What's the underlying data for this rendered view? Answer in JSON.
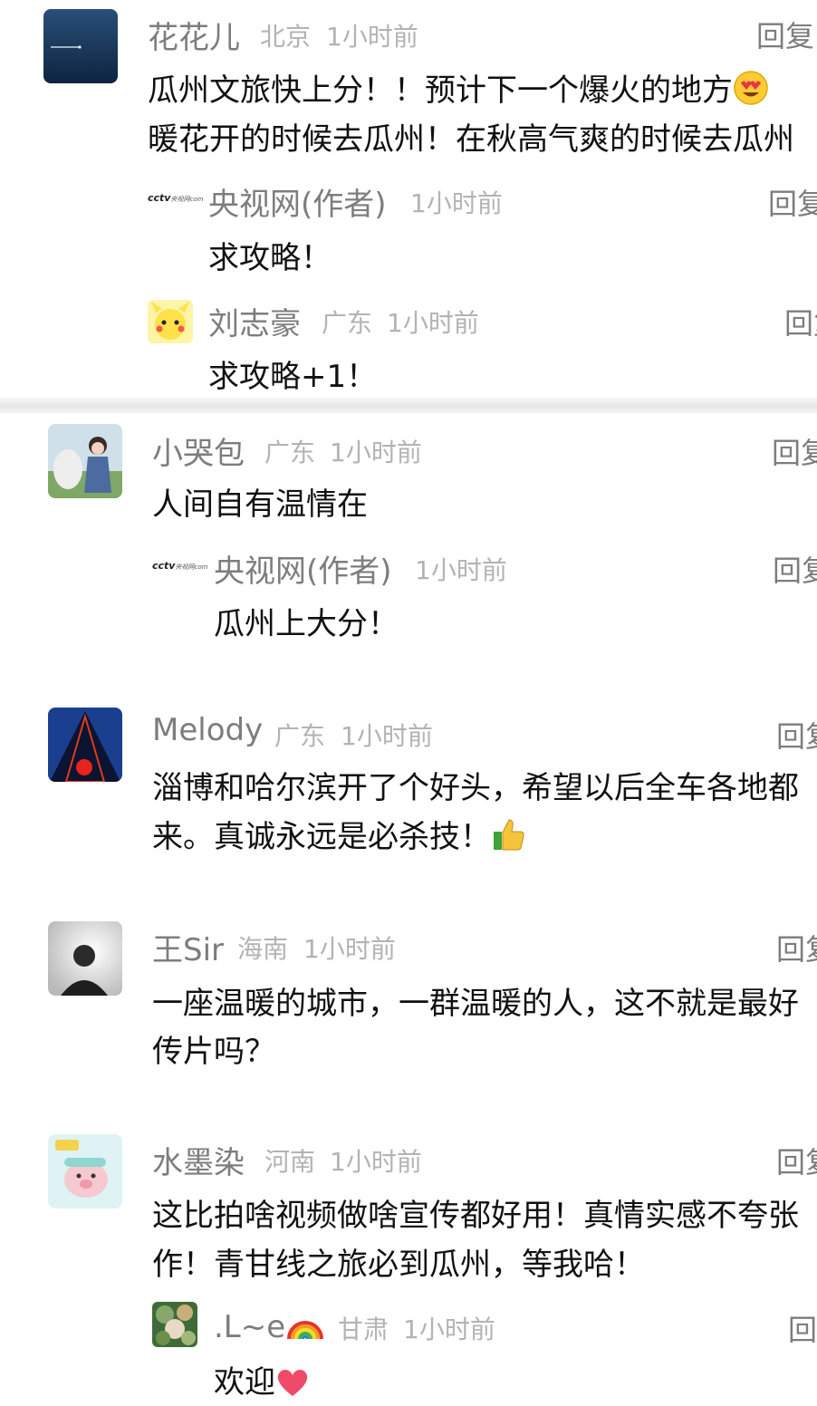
{
  "labels": {
    "reply": "回复",
    "reply_truncated": "回复",
    "cctv_logo": "cctv",
    "cctv_logo_sub": "央视网com"
  },
  "comments": [
    {
      "name": "花花儿",
      "location": "北京",
      "time": "1小时前",
      "lines": [
        "瓜州文旅快上分！！预计下一个爆火的地方",
        "暖花开的时候去瓜州！在秋高气爽的时候去瓜州"
      ],
      "emoji": "heart-eyes-emoji",
      "replies": [
        {
          "name": "央视网(作者)",
          "location": "",
          "time": "1小时前",
          "text": "求攻略！"
        },
        {
          "name": "刘志豪",
          "location": "广东",
          "time": "1小时前",
          "text": "求攻略+1！"
        }
      ]
    },
    {
      "name": "小哭包",
      "location": "广东",
      "time": "1小时前",
      "lines": [
        "人间自有温情在"
      ],
      "replies": [
        {
          "name": "央视网(作者)",
          "location": "",
          "time": "1小时前",
          "text": "瓜州上大分！"
        }
      ]
    },
    {
      "name": "Melody",
      "location": "广东",
      "time": "1小时前",
      "lines": [
        "淄博和哈尔滨开了个好头，希望以后全车各地都",
        "来。真诚永远是必杀技！"
      ],
      "emoji": "thumbs-up-emoji"
    },
    {
      "name": "王Sir",
      "location": "海南",
      "time": "1小时前",
      "lines": [
        "一座温暖的城市，一群温暖的人，这不就是最好",
        "传片吗？"
      ]
    },
    {
      "name": "水墨染",
      "location": "河南",
      "time": "1小时前",
      "lines": [
        "这比拍啥视频做啥宣传都好用！真情实感不夸张",
        "作！青甘线之旅必到瓜州，等我哈！"
      ],
      "replies": [
        {
          "name": ".L~e",
          "name_emoji": "rainbow-emoji",
          "location": "甘肃",
          "time": "1小时前",
          "text": "欢迎",
          "text_emoji": "heart-emoji"
        }
      ]
    }
  ]
}
